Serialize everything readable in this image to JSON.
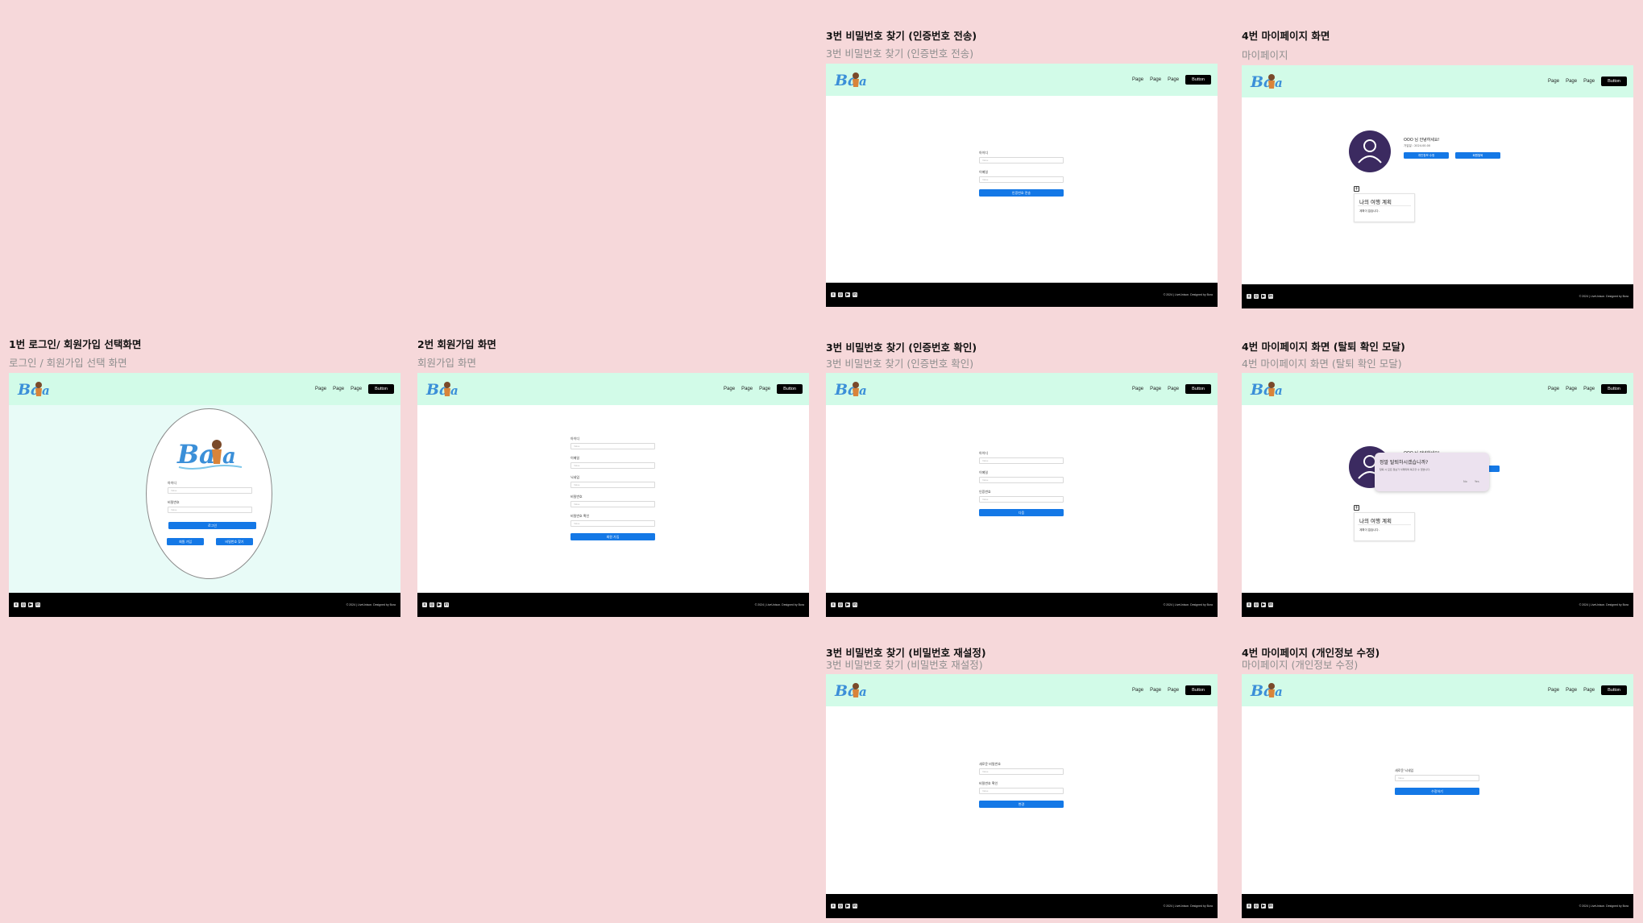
{
  "nav": {
    "links": [
      "Page",
      "Page",
      "Page"
    ],
    "button": "Button"
  },
  "footer": {
    "copyright": "© 2024 | LiveUnison. Designed by Bora"
  },
  "form_common": {
    "placeholder": "Value"
  },
  "frames": {
    "pw_send": {
      "title": "3번 비밀번호 찾기 (인증번호 전송)",
      "subtitle": "3번 비밀번호 찾기 (인증번호 전송)",
      "labels": [
        "아이디",
        "이메일"
      ],
      "button": "인증번호 전송"
    },
    "mypage": {
      "title": "4번 마이페이지 화면",
      "subtitle": "마이페이지",
      "greeting": "OOO 님 안녕하세요!",
      "greeting_sub": "가입일 : 2024.00.00",
      "edit_button": "개인정보 수정",
      "leave_button": "회원탈퇴",
      "plus": "+",
      "trip_title": "나의 여행 계획",
      "trip_text": "계획이 없습니다."
    },
    "login": {
      "title": "1번 로그인/ 회원가입 선택화면",
      "subtitle": "로그인 / 회원가입 선택 화면",
      "labels": [
        "아이디",
        "비밀번호"
      ],
      "login_button": "로그인",
      "signup_button": "회원 가입",
      "findpw_button": "비밀번호 찾기"
    },
    "signup": {
      "title": "2번 회원가입 화면",
      "subtitle": "회원가입 화면",
      "labels": [
        "아이디",
        "이메일",
        "닉네임",
        "비밀번호",
        "비밀번호 확인"
      ],
      "button": "회원 가입"
    },
    "pw_verify": {
      "title": "3번 비밀번호 찾기 (인증번호 확인)",
      "subtitle": "3번 비밀번호 찾기 (인증번호 확인)",
      "labels": [
        "아이디",
        "이메일",
        "인증번호"
      ],
      "button": "다음"
    },
    "mypage_modal": {
      "title": "4번 마이페이지 화면 (탈퇴 확인 모달)",
      "subtitle": "4번 마이페이지 화면 (탈퇴 확인 모달)",
      "greeting": "OOO 님 안녕하세요!",
      "modal_title": "정말 탈퇴하시겠습니까?",
      "modal_text": "탈퇴 시 모든 정보가 삭제되며 복구할 수 없습니다.",
      "modal_no": "No",
      "modal_yes": "Yes",
      "plus": "+",
      "trip_title": "나의 여행 계획",
      "trip_text": "계획이 없습니다."
    },
    "pw_reset": {
      "title": "3번 비밀번호 찾기 (비밀번호 재설정)",
      "subtitle": "3번 비밀번호 찾기 (비밀번호 재설정)",
      "labels": [
        "새로운 비밀번호",
        "비밀번호 확인"
      ],
      "button": "변경"
    },
    "profile_edit": {
      "title": "4번 마이페이지 (개인정보 수정)",
      "subtitle": "마이페이지 (개인정보 수정)",
      "labels": [
        "새로운 닉네임"
      ],
      "button": "수정하기"
    }
  }
}
